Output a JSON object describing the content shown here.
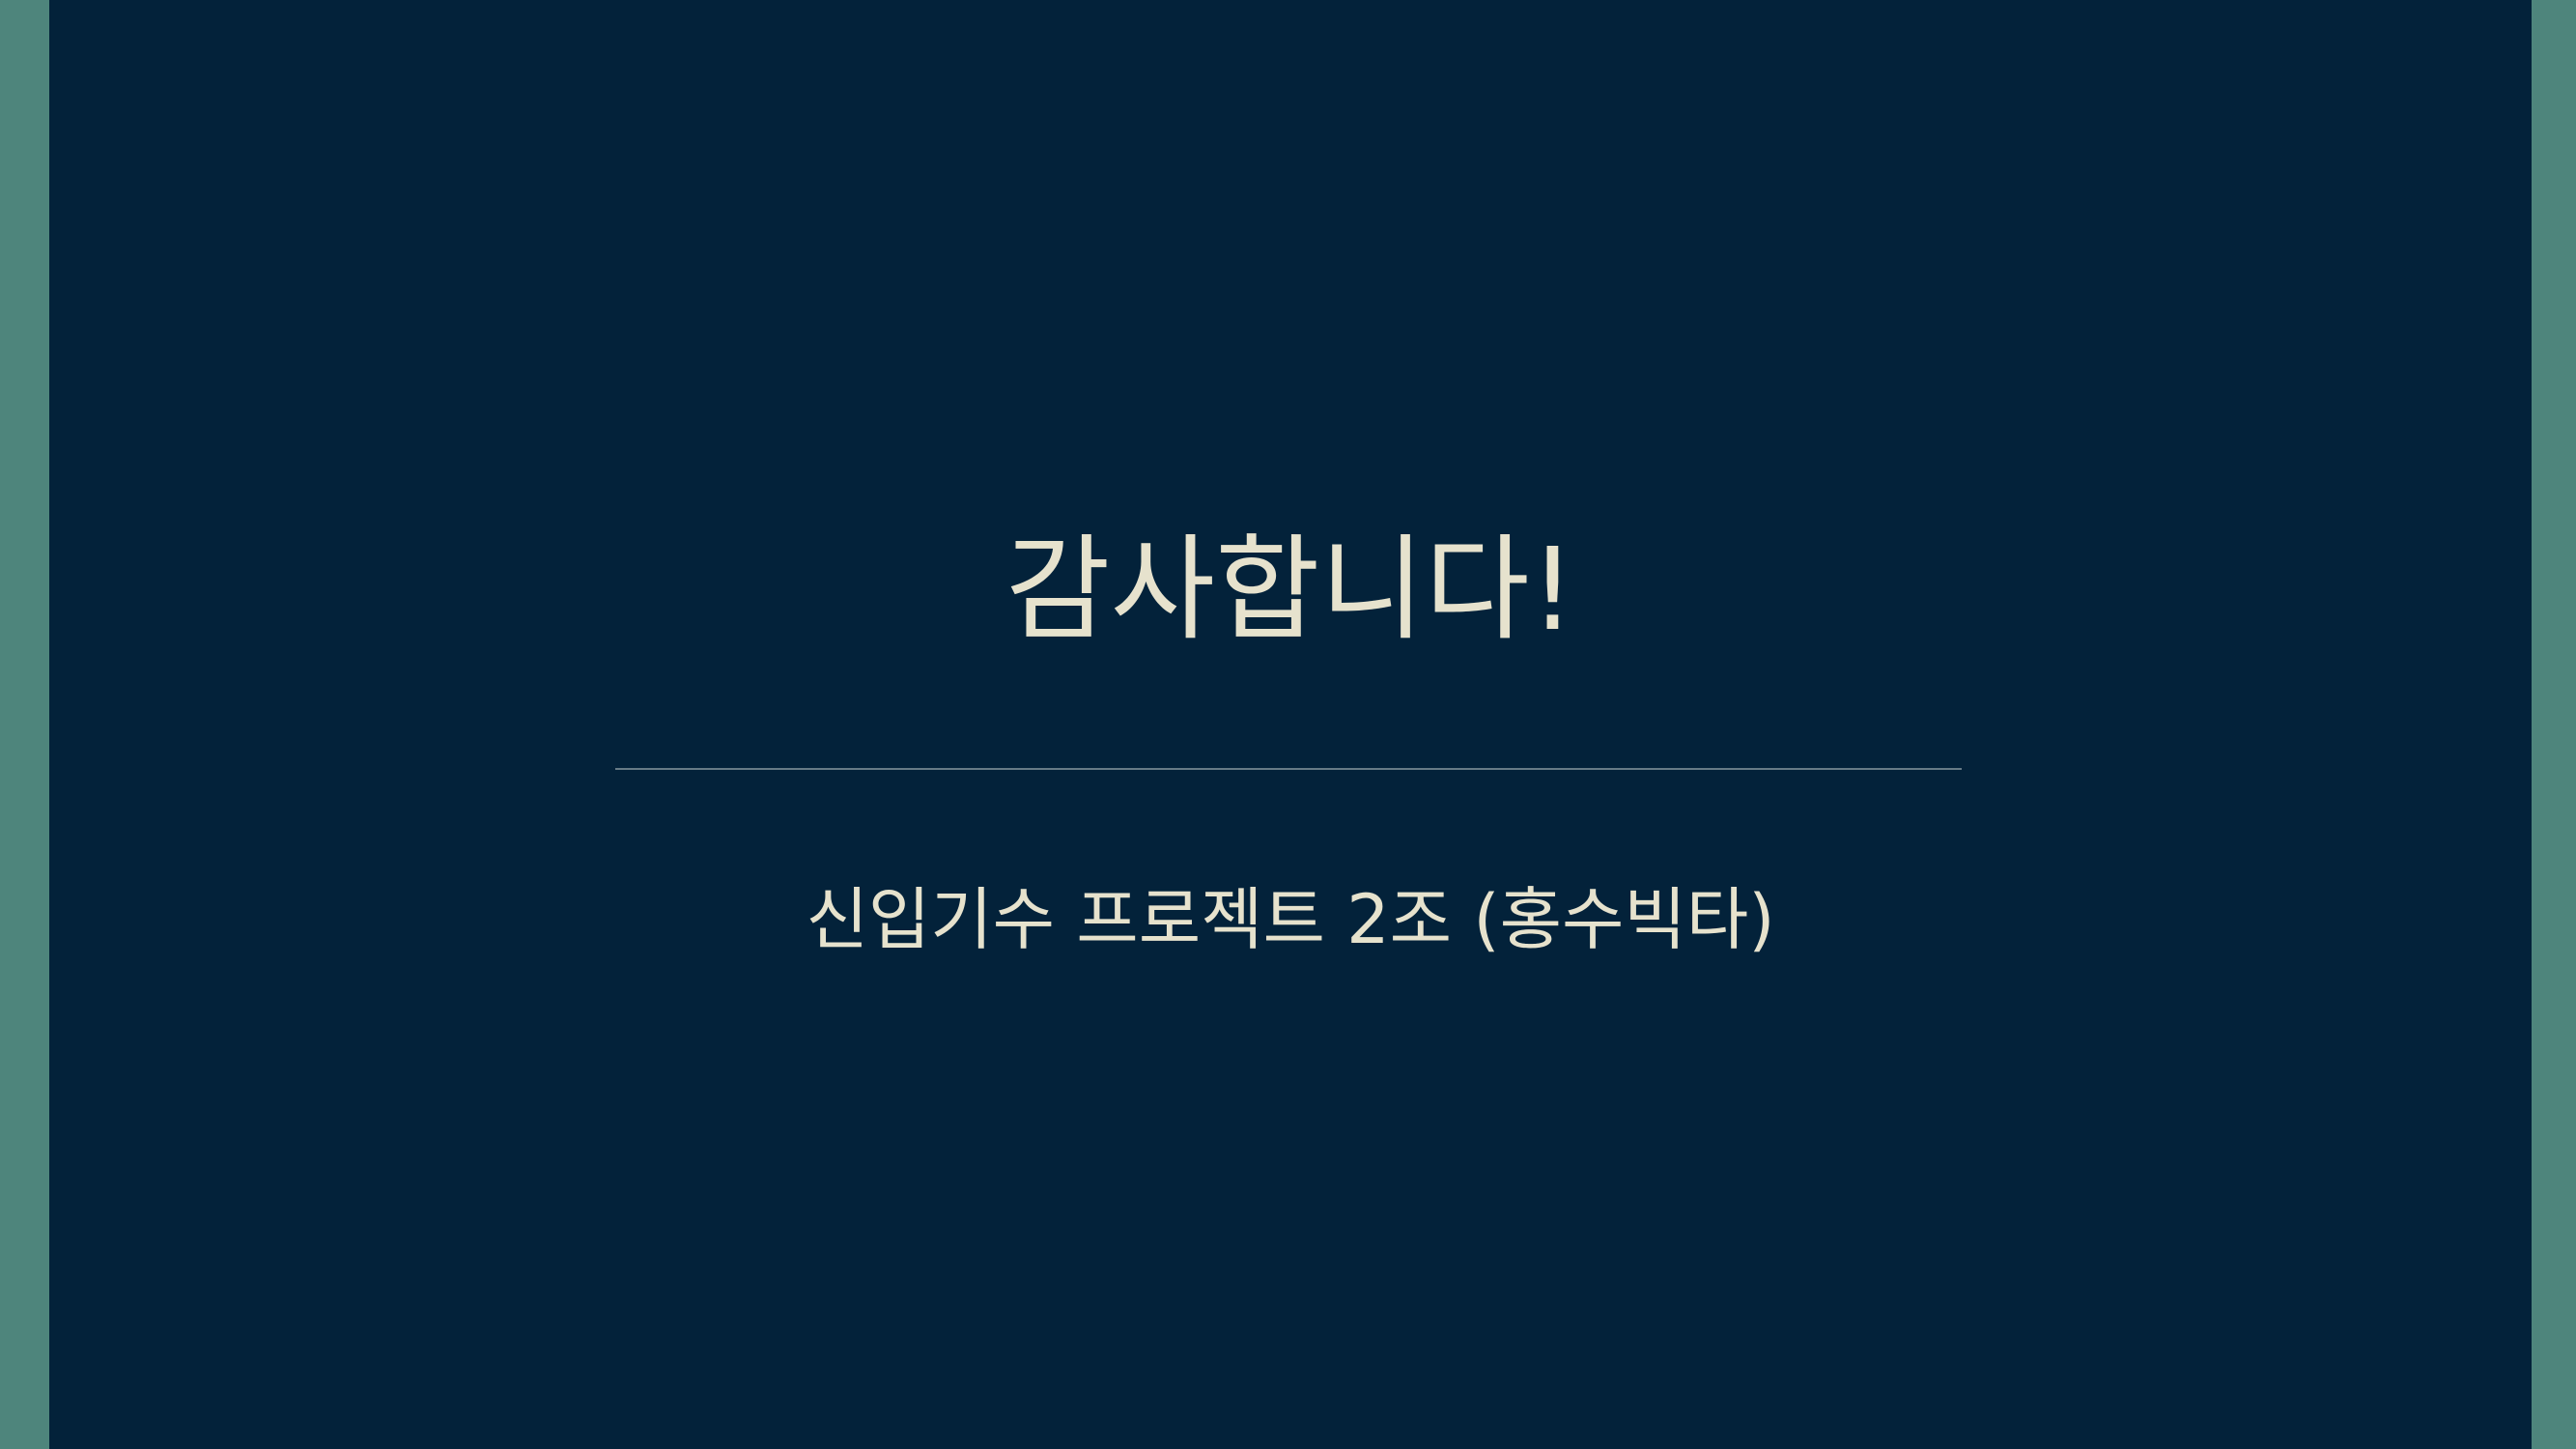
{
  "slide": {
    "title": "감사합니다!",
    "subtitle": "신입기수 프로젝트 2조 (홍수빅타)"
  },
  "colors": {
    "background": "#03223a",
    "side_border": "#4e857c",
    "text": "#e6e2cd",
    "divider": "#8a9aa0"
  }
}
